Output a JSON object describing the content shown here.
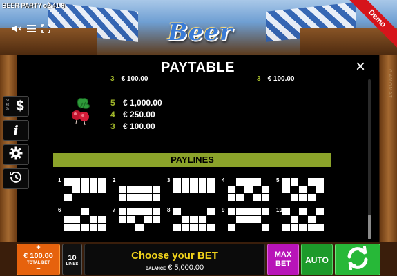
{
  "header": {
    "version": "BEER PARTY o2.41.8",
    "logo_text": "Beer Party",
    "demo_label": "Demo",
    "provider": "GAMOMAT"
  },
  "paytable": {
    "title": "PAYTABLE",
    "close_label": "×",
    "cut_rows": [
      {
        "n": "3",
        "amount": "€ 100.00"
      },
      {
        "n": "3",
        "amount": "€ 100.00"
      }
    ],
    "symbol_icon": "radish-icon",
    "payouts": [
      {
        "n": "5",
        "amount": "€ 1,000.00"
      },
      {
        "n": "4",
        "amount": "€ 250.00"
      },
      {
        "n": "3",
        "amount": "€ 100.00"
      }
    ],
    "paylines_title": "PAYLINES",
    "paylines": [
      {
        "n": "1",
        "rows": [
          1,
          2,
          2,
          2,
          2
        ]
      },
      {
        "n": "2",
        "rows": [
          0,
          0,
          0,
          0,
          0
        ]
      },
      {
        "n": "3",
        "rows": [
          2,
          2,
          2,
          2,
          2
        ]
      },
      {
        "n": "4",
        "rows": [
          0,
          1,
          2,
          1,
          0
        ]
      },
      {
        "n": "5",
        "rows": [
          2,
          1,
          0,
          1,
          2
        ]
      },
      {
        "n": "6",
        "rows": [
          0,
          0,
          1,
          0,
          0
        ]
      },
      {
        "n": "7",
        "rows": [
          2,
          2,
          1,
          2,
          2
        ]
      },
      {
        "n": "8",
        "rows": [
          1,
          0,
          0,
          0,
          1
        ]
      },
      {
        "n": "9",
        "rows": [
          1,
          2,
          2,
          2,
          1
        ]
      },
      {
        "n": "10",
        "rows": [
          1,
          0,
          1,
          0,
          1
        ]
      }
    ]
  },
  "side_menu": {
    "paytable_multipliers": "5x\n4x\n3x",
    "paytable_icon": "$",
    "info_icon": "i"
  },
  "bottom": {
    "total_bet_plus": "+",
    "total_bet_value": "€ 100.00",
    "total_bet_label": "TOTAL BET",
    "total_bet_minus": "−",
    "lines_value": "10",
    "lines_label": "LINES",
    "choose_label": "Choose your BET",
    "balance_label": "BALANCE",
    "balance_value": "€ 5,000.00",
    "maxbet_line1": "MAX",
    "maxbet_line2": "BET",
    "auto_label": "AUTO"
  },
  "colors": {
    "accent_green": "#8ba32a",
    "payout_number": "#9fb52a",
    "total_bet_orange": "#e6620d",
    "max_bet_magenta": "#b814b8",
    "auto_green": "#1d9a2a",
    "spin_green": "#27b838",
    "choose_yellow": "#f0d21a"
  }
}
